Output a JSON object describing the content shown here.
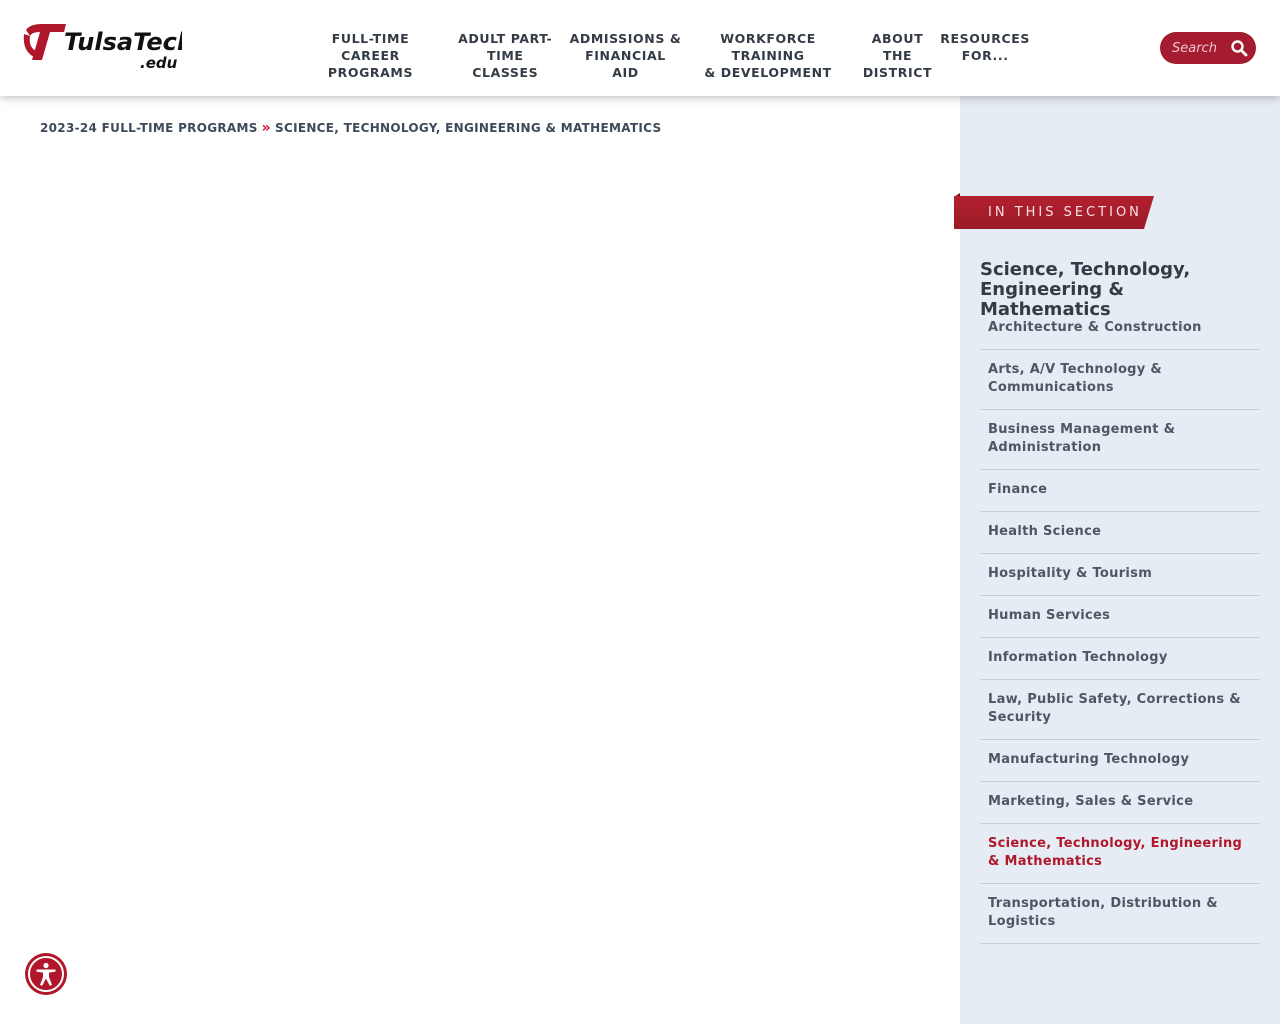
{
  "header": {
    "logo_text": "TulsaTech",
    "logo_suffix": ".edu",
    "nav": [
      {
        "label": "FULL-TIME CAREER\nPROGRAMS"
      },
      {
        "label": "ADULT PART-TIME\nCLASSES"
      },
      {
        "label": "ADMISSIONS &\nFINANCIAL AID"
      },
      {
        "label": "WORKFORCE TRAINING\n& DEVELOPMENT"
      },
      {
        "label": "ABOUT THE\nDISTRICT"
      },
      {
        "label": "RESOURCES\nFOR..."
      }
    ],
    "search": {
      "placeholder": "Search"
    }
  },
  "breadcrumb": {
    "parent": "2023-24 FULL-TIME PROGRAMS",
    "separator": "»",
    "current": "SCIENCE, TECHNOLOGY, ENGINEERING & MATHEMATICS"
  },
  "sidebar": {
    "tab_label": "IN THIS SECTION",
    "heading": "Science, Technology, Engineering & Mathematics",
    "items": [
      {
        "label": "Architecture & Construction"
      },
      {
        "label": "Arts, A/V Technology & Communications"
      },
      {
        "label": "Business Management & Administration"
      },
      {
        "label": "Finance"
      },
      {
        "label": "Health Science"
      },
      {
        "label": "Hospitality & Tourism"
      },
      {
        "label": "Human Services"
      },
      {
        "label": "Information Technology"
      },
      {
        "label": "Law, Public Safety, Corrections & Security"
      },
      {
        "label": "Manufacturing Technology"
      },
      {
        "label": "Marketing, Sales & Service"
      },
      {
        "label": "Science, Technology, Engineering & Mathematics",
        "active": true
      },
      {
        "label": "Transportation, Distribution & Logistics"
      }
    ]
  },
  "colors": {
    "brand_red": "#b0172b",
    "search_red": "#a51b2f",
    "sidebar_bg": "#e6ecf3",
    "nav_text": "#333b45"
  },
  "icons": {
    "search": "search-icon",
    "accessibility": "accessibility-icon"
  }
}
